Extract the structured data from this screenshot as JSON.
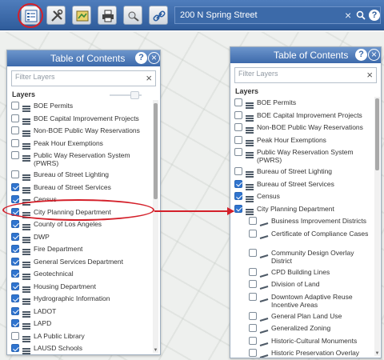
{
  "toolbar": {
    "search_value": "200 N Spring Street",
    "clear_symbol": "×",
    "help_symbol": "?",
    "icons": [
      "table-of-contents-icon",
      "tools-icon",
      "map-layers-icon",
      "print-icon",
      "measure-icon",
      "link-icon",
      "search-icon"
    ],
    "accent": "#2f5c9b"
  },
  "panel_left": {
    "title": "Table of Contents",
    "help_symbol": "?",
    "close_symbol": "×",
    "filter_placeholder": "Filter Layers",
    "clear_symbol": "×",
    "layers_heading": "Layers",
    "items": [
      {
        "label": "BOE Permits",
        "checked": false
      },
      {
        "label": "BOE Capital Improvement Projects",
        "checked": false
      },
      {
        "label": "Non-BOE Public Way Reservations",
        "checked": false
      },
      {
        "label": "Peak Hour Exemptions",
        "checked": false
      },
      {
        "label": "Public Way Reservation System (PWRS)",
        "checked": false
      },
      {
        "label": "Bureau of Street Lighting",
        "checked": false
      },
      {
        "label": "Bureau of Street Services",
        "checked": true
      },
      {
        "label": "Census",
        "checked": true
      },
      {
        "label": "City Planning Department",
        "checked": true
      },
      {
        "label": "County of Los Angeles",
        "checked": true
      },
      {
        "label": "DWP",
        "checked": true
      },
      {
        "label": "Fire Department",
        "checked": true
      },
      {
        "label": "General Services Department",
        "checked": true
      },
      {
        "label": "Geotechnical",
        "checked": true
      },
      {
        "label": "Housing Department",
        "checked": true
      },
      {
        "label": "Hydrographic Information",
        "checked": true
      },
      {
        "label": "LADOT",
        "checked": true
      },
      {
        "label": "LAPD",
        "checked": true
      },
      {
        "label": "LA Public Library",
        "checked": false
      },
      {
        "label": "LAUSD Schools",
        "checked": true
      }
    ]
  },
  "panel_right": {
    "title": "Table of Contents",
    "help_symbol": "?",
    "close_symbol": "×",
    "filter_placeholder": "Filter Layers",
    "clear_symbol": "×",
    "layers_heading": "Layers",
    "items": [
      {
        "label": "BOE Permits",
        "checked": false,
        "level": 0
      },
      {
        "label": "BOE Capital Improvement Projects",
        "checked": false,
        "level": 0
      },
      {
        "label": "Non-BOE Public Way Reservations",
        "checked": false,
        "level": 0
      },
      {
        "label": "Peak Hour Exemptions",
        "checked": false,
        "level": 0
      },
      {
        "label": "Public Way Reservation System (PWRS)",
        "checked": false,
        "level": 0
      },
      {
        "label": "Bureau of Street Lighting",
        "checked": false,
        "level": 0
      },
      {
        "label": "Bureau of Street Services",
        "checked": true,
        "level": 0
      },
      {
        "label": "Census",
        "checked": true,
        "level": 0
      },
      {
        "label": "City Planning Department",
        "checked": true,
        "level": 0
      },
      {
        "label": "Business Improvement Districts",
        "checked": false,
        "level": 1
      },
      {
        "label": "Certificate of Compliance Cases",
        "checked": false,
        "level": 1
      },
      {
        "label": "Community Design Overlay District",
        "checked": false,
        "level": 1
      },
      {
        "label": "CPD Building Lines",
        "checked": false,
        "level": 1
      },
      {
        "label": "Division of Land",
        "checked": false,
        "level": 1
      },
      {
        "label": "Downtown Adaptive Reuse Incentive Areas",
        "checked": false,
        "level": 1
      },
      {
        "label": "General Plan Land Use",
        "checked": false,
        "level": 1
      },
      {
        "label": "Generalized Zoning",
        "checked": false,
        "level": 1
      },
      {
        "label": "Historic-Cultural Monuments",
        "checked": false,
        "level": 1
      },
      {
        "label": "Historic Preservation Overlay",
        "checked": false,
        "level": 1
      }
    ]
  },
  "colors": {
    "highlight": "#d4202a",
    "checkbox_on": "#2f74cf",
    "header": "#3d6aab"
  }
}
